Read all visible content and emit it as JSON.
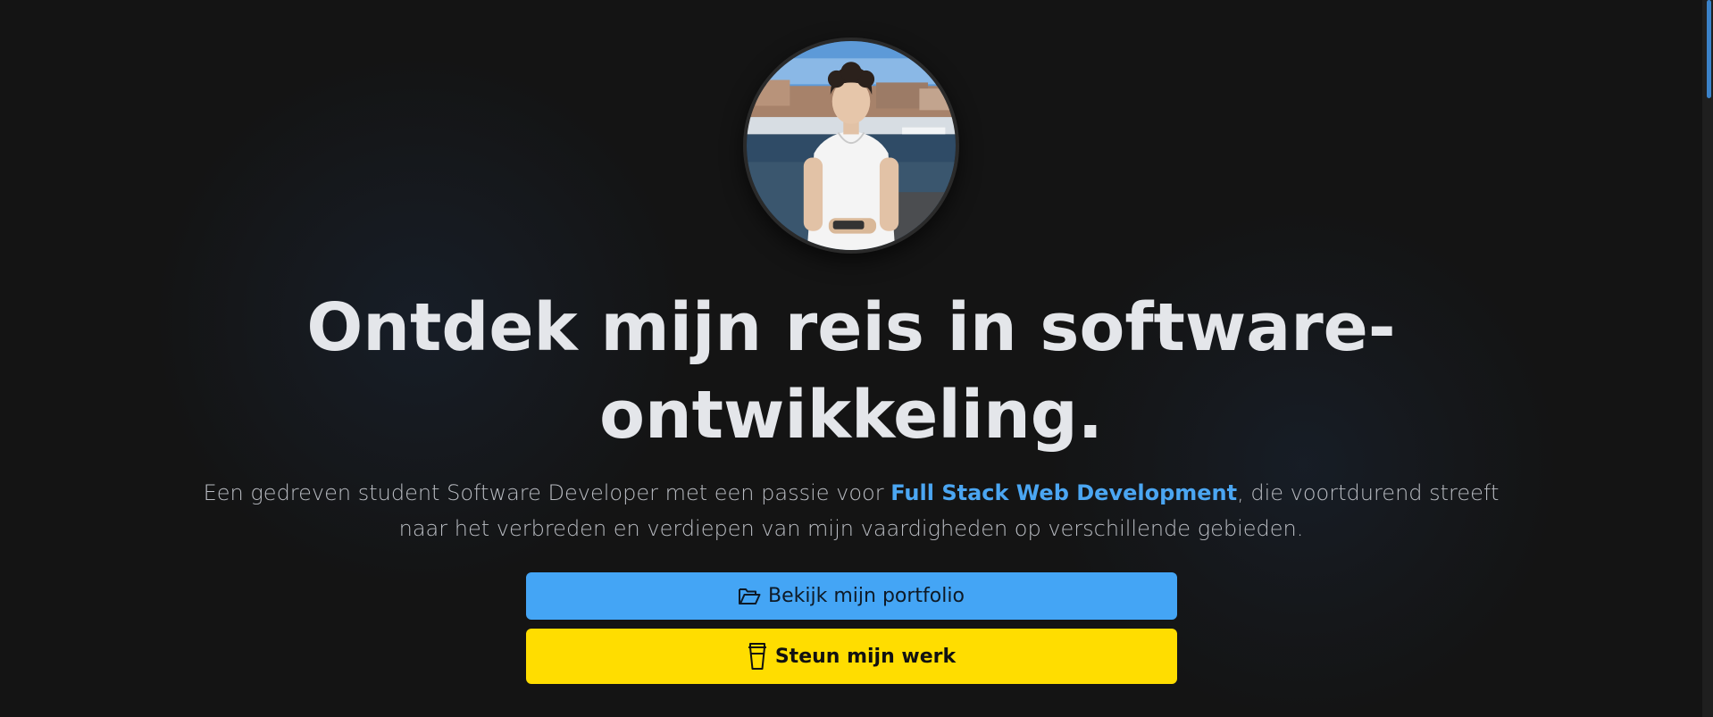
{
  "hero": {
    "avatar_alt": "Profielfoto",
    "headline": "Ontdek mijn reis in software-ontwikkeling.",
    "intro_before": "Een gedreven student Software Developer met een passie voor ",
    "intro_highlight": "Full Stack Web Development",
    "intro_after": ", die voortdurend streeft naar het verbreden en verdiepen van mijn vaardigheden op verschillende gebieden."
  },
  "buttons": {
    "portfolio_label": "Bekijk mijn portfolio",
    "portfolio_icon": "folder-open-icon",
    "support_label": "Steun mijn werk",
    "support_icon": "coffee-cup-icon"
  },
  "colors": {
    "background": "#141414",
    "accent_blue": "#44a5f5",
    "highlight_blue": "#4ba6f2",
    "support_yellow": "#ffdd00",
    "headline": "#e4e6ea"
  }
}
